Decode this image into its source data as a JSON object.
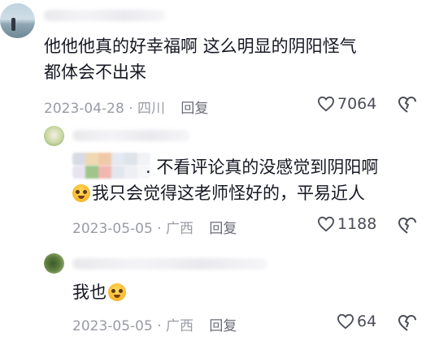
{
  "comments": [
    {
      "text_line1": "他他他真的好幸福啊  这么明显的阴阳怪气",
      "text_line2": "都体会不出来",
      "date_location": "2023-04-28 · 四川",
      "reply_label": "回复",
      "likes": "7064"
    },
    {
      "text_line1": ". 不看评论真的没感觉到阴阳啊",
      "text_line2": "我只会觉得这老师怪好的，平易近人",
      "date_location": "2023-05-05 · 广西",
      "reply_label": "回复",
      "likes": "1188"
    },
    {
      "text_line1": "我也",
      "date_location": "2023-05-05 · 广西",
      "reply_label": "回复",
      "likes": "64"
    }
  ],
  "icons": {
    "heart": "heart-outline-icon",
    "dislike": "dislike-outline-icon",
    "emoji": "crying-face-emoji"
  },
  "colors": {
    "text": "#161823",
    "meta": "#9a9ca5",
    "reply": "#6b6d76"
  }
}
